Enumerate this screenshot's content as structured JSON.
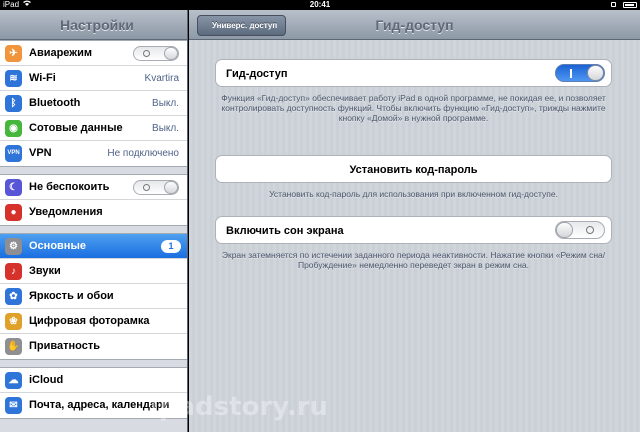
{
  "status": {
    "device": "iPad",
    "time": "20:41"
  },
  "sidebar": {
    "title": "Настройки",
    "sections": [
      [
        {
          "name": "airplane-mode",
          "icon": "airplane-icon",
          "icon_color": "#f0953b",
          "glyph": "✈",
          "label": "Авиарежим",
          "type": "switch"
        },
        {
          "name": "wifi",
          "icon": "wifi-icon",
          "icon_color": "#2f74d8",
          "glyph": "≋",
          "label": "Wi-Fi",
          "value": "Kvartira"
        },
        {
          "name": "bluetooth",
          "icon": "bluetooth-icon",
          "icon_color": "#2f74d8",
          "glyph": "ᛒ",
          "label": "Bluetooth",
          "value": "Выкл."
        },
        {
          "name": "cellular",
          "icon": "cellular-icon",
          "icon_color": "#46b63c",
          "glyph": "◉",
          "label": "Сотовые данные",
          "value": "Выкл."
        },
        {
          "name": "vpn",
          "icon": "vpn-icon",
          "icon_color": "#2f74d8",
          "glyph": "VPN",
          "label": "VPN",
          "value": "Не подключено"
        }
      ],
      [
        {
          "name": "do-not-disturb",
          "icon": "moon-icon",
          "icon_color": "#5856d6",
          "glyph": "☾",
          "label": "Не беспокоить",
          "type": "switch"
        },
        {
          "name": "notifications",
          "icon": "notifications-icon",
          "icon_color": "#d6322b",
          "glyph": "●",
          "label": "Уведомления"
        }
      ],
      [
        {
          "name": "general",
          "icon": "gear-icon",
          "icon_color": "#8e8e93",
          "glyph": "⚙",
          "label": "Основные",
          "badge": "1",
          "selected": true
        },
        {
          "name": "sounds",
          "icon": "speaker-icon",
          "icon_color": "#d6322b",
          "glyph": "♪",
          "label": "Звуки"
        },
        {
          "name": "brightness",
          "icon": "flower-icon",
          "icon_color": "#2f74d8",
          "glyph": "✿",
          "label": "Яркость и обои"
        },
        {
          "name": "photos",
          "icon": "photos-icon",
          "icon_color": "#e0a12b",
          "glyph": "❀",
          "label": "Цифровая фоторамка"
        },
        {
          "name": "privacy",
          "icon": "hand-icon",
          "icon_color": "#8e8e93",
          "glyph": "✋",
          "label": "Приватность"
        }
      ],
      [
        {
          "name": "icloud",
          "icon": "cloud-icon",
          "icon_color": "#2f74d8",
          "glyph": "☁",
          "label": "iCloud"
        },
        {
          "name": "mail",
          "icon": "mail-icon",
          "icon_color": "#2f74d8",
          "glyph": "✉",
          "label": "Почта, адреса, календари"
        }
      ]
    ]
  },
  "navbar": {
    "back_label": "Универс. доступ",
    "title": "Гид-доступ"
  },
  "guided_access": {
    "label": "Гид-доступ",
    "state": "on",
    "footer": "Функция «Гид-доступ» обеспечивает работу iPad в одной программе, не покидая ее, и позволяет контролировать доступность функций. Чтобы включить функцию «Гид-доступ», трижды нажмите кнопку «Домой» в нужной программе."
  },
  "passcode": {
    "label": "Установить код-пароль",
    "footer": "Установить код-пароль для использования при включенном гид-доступе."
  },
  "screen_sleep": {
    "label": "Включить сон экрана",
    "state": "off",
    "footer": "Экран затемняется по истечении заданного периода неактивности. Нажатие кнопки «Режим сна/Пробуждение» немедленно переведет экран в режим сна."
  },
  "watermark": "ipadstory.ru"
}
